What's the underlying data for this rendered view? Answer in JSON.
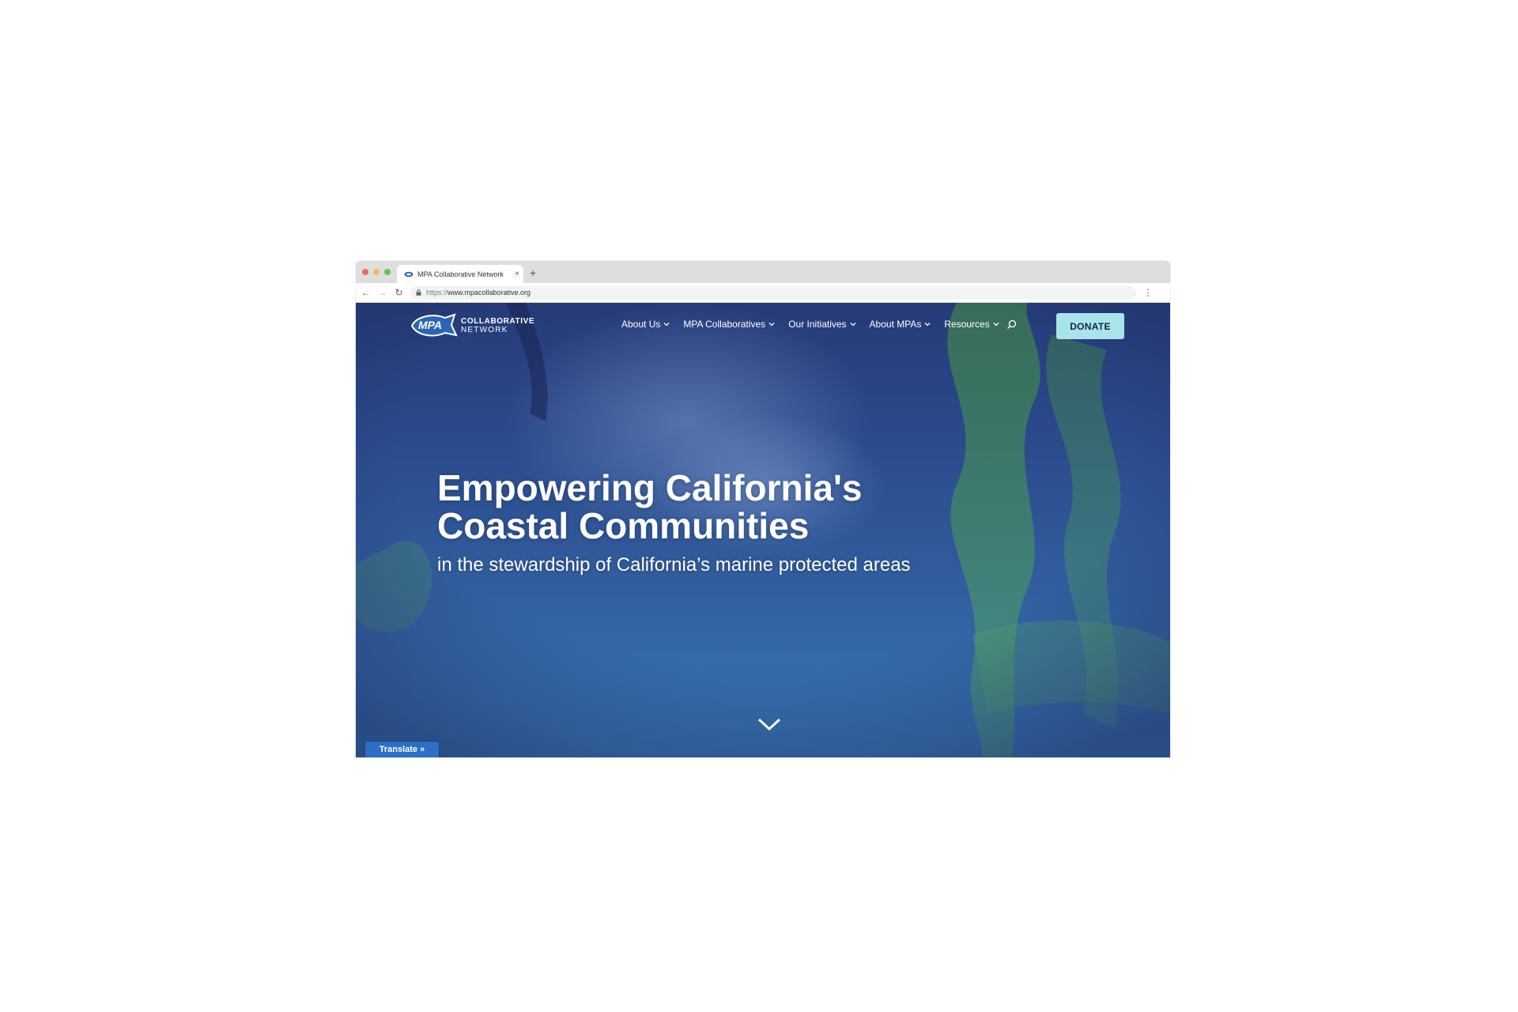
{
  "browser": {
    "tab_title": "MPA Collaborative Network",
    "tab_close": "×",
    "new_tab": "+",
    "url_scheme": "https://",
    "url_host": "www.mpacollaborative.org",
    "back": "←",
    "forward": "→",
    "reload": "↻",
    "menu": "⋮"
  },
  "site": {
    "logo": {
      "badge_text": "MPA",
      "line1": "COLLABORATIVE",
      "line2": "NETWORK"
    },
    "nav": [
      {
        "label": "About Us"
      },
      {
        "label": "MPA Collaboratives"
      },
      {
        "label": "Our Initiatives"
      },
      {
        "label": "About MPAs"
      },
      {
        "label": "Resources"
      }
    ],
    "donate_label": "DONATE",
    "hero": {
      "title": "Empowering California's Coastal Communities",
      "subtitle": "in the stewardship of California’s marine protected areas"
    },
    "translate_label": "Translate »"
  },
  "icons": {
    "search": "search-icon",
    "chevron": "chevron-down-icon",
    "scroll": "scroll-down-chevron-icon",
    "lock": "lock-icon"
  },
  "colors": {
    "hero_top": "#263b78",
    "hero_bottom": "#3a78b8",
    "donate_bg": "#a9e4ea",
    "translate_bg": "#2d6fc5",
    "kelp": "#4b9a5a"
  }
}
